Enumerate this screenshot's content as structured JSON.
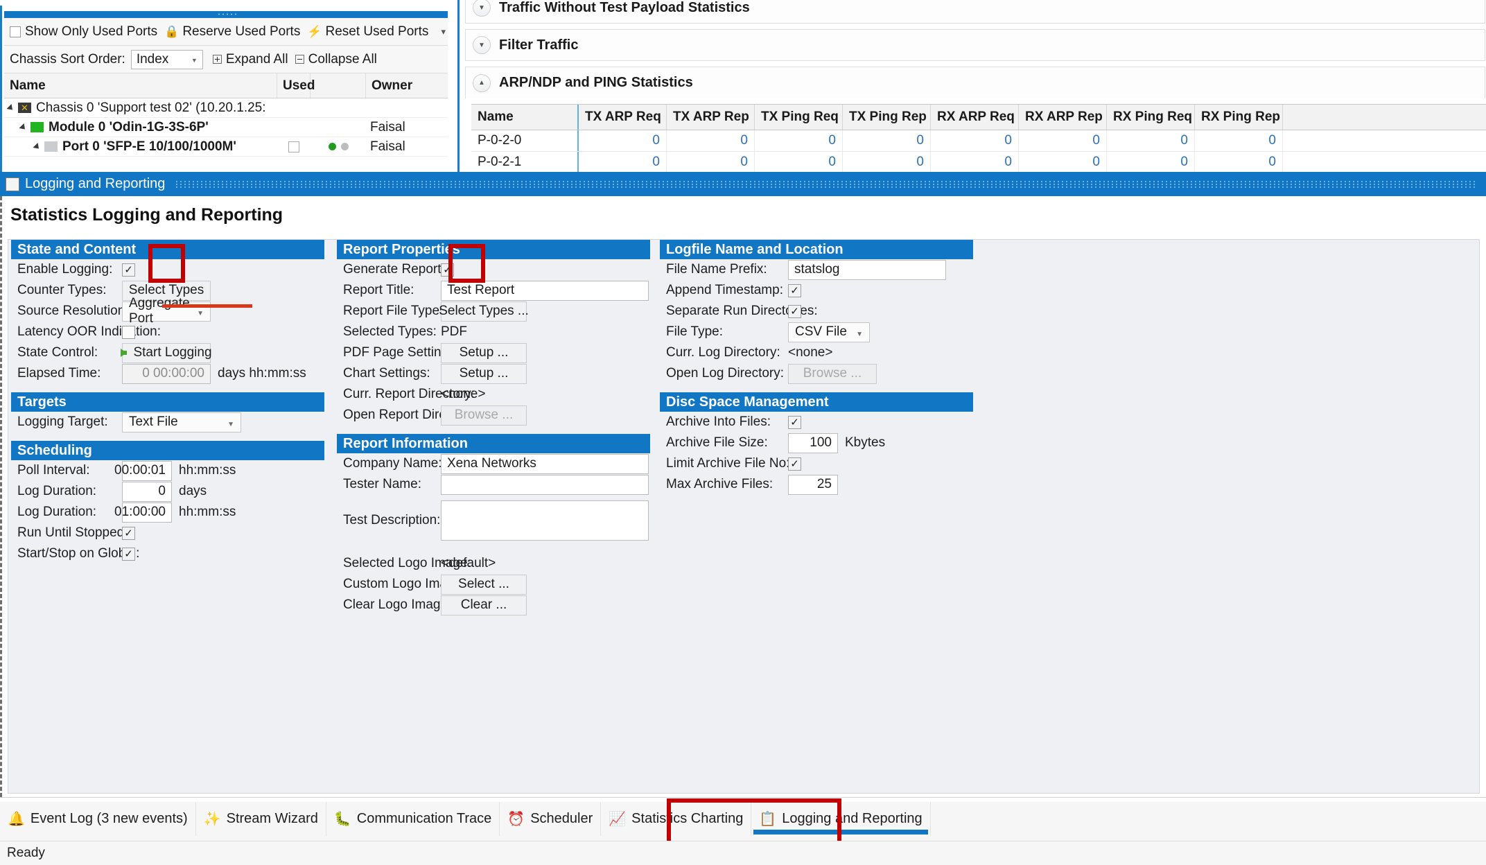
{
  "port_panel": {
    "toolbar": {
      "show_only_used_ports": "Show Only Used Ports",
      "reserve_used_ports": "Reserve Used Ports",
      "reset_used_ports": "Reset Used Ports",
      "chassis_sort_order_label": "Chassis Sort Order:",
      "chassis_sort_order_value": "Index",
      "expand_all": "Expand All",
      "collapse_all": "Collapse All"
    },
    "columns": [
      "Name",
      "Used",
      "",
      "Owner"
    ],
    "rows": [
      {
        "name": "Chassis 0 'Support test 02' (10.20.1.25:",
        "used": "",
        "owner": ""
      },
      {
        "name": "Module 0 'Odin-1G-3S-6P'",
        "used": "",
        "owner": "Faisal"
      },
      {
        "name": "Port 0 'SFP-E 10/100/1000M'",
        "used": "",
        "owner": "Faisal"
      }
    ]
  },
  "stats_panel": {
    "sections": [
      {
        "label": "Traffic Without Test Payload Statistics",
        "expanded": false
      },
      {
        "label": "Filter Traffic",
        "expanded": false
      },
      {
        "label": "ARP/NDP and PING Statistics",
        "expanded": true
      }
    ],
    "table": {
      "columns": [
        "Name",
        "TX ARP Req",
        "TX ARP Rep",
        "TX Ping Req",
        "TX Ping Rep",
        "RX ARP Req",
        "RX ARP Rep",
        "RX Ping Req",
        "RX Ping Rep",
        ""
      ],
      "rows": [
        [
          "P-0-2-0",
          "0",
          "0",
          "0",
          "0",
          "0",
          "0",
          "0",
          "0",
          ""
        ],
        [
          "P-0-2-1",
          "0",
          "0",
          "0",
          "0",
          "0",
          "0",
          "0",
          "0",
          ""
        ]
      ]
    }
  },
  "panel": {
    "titlebar": "Logging and Reporting",
    "page_title": "Statistics Logging and Reporting"
  },
  "state_and_content": {
    "header": "State and Content",
    "enable_logging_label": "Enable Logging:",
    "enable_logging_checked": "✓",
    "counter_types_label": "Counter Types:",
    "counter_types_button": "Select Types",
    "source_resolution_label": "Source Resolution:",
    "source_resolution_value": "Aggregate Port",
    "latency_oor_label": "Latency OOR Indication:",
    "latency_oor_checked": "",
    "state_control_label": "State Control:",
    "state_control_button": "Start Logging",
    "elapsed_time_label": "Elapsed Time:",
    "elapsed_time_value": "0 00:00:00",
    "elapsed_time_unit": "days hh:mm:ss"
  },
  "targets": {
    "header": "Targets",
    "logging_target_label": "Logging Target:",
    "logging_target_value": "Text File"
  },
  "scheduling": {
    "header": "Scheduling",
    "poll_interval_label": "Poll Interval:",
    "poll_interval_value": "00:00:01",
    "poll_interval_unit": "hh:mm:ss",
    "log_duration_days_label": "Log Duration:",
    "log_duration_days_value": "0",
    "log_duration_days_unit": "days",
    "log_duration_time_label": "Log Duration:",
    "log_duration_time_value": "01:00:00",
    "log_duration_time_unit": "hh:mm:ss",
    "run_until_stopped_label": "Run Until Stopped:",
    "run_until_stopped_checked": "✓",
    "start_stop_global_label": "Start/Stop on Global:",
    "start_stop_global_checked": "✓"
  },
  "report_properties": {
    "header": "Report Properties",
    "generate_report_label": "Generate Report:",
    "generate_report_checked": "✓",
    "report_title_label": "Report Title:",
    "report_title_value": "Test Report",
    "report_file_types_label": "Report File Types:",
    "report_file_types_button": "Select Types ...",
    "selected_types_label": "Selected Types:",
    "selected_types_value": "PDF",
    "pdf_page_settings_label": "PDF Page Settings:",
    "pdf_page_settings_button": "Setup ...",
    "chart_settings_label": "Chart Settings:",
    "chart_settings_button": "Setup ...",
    "curr_report_directory_label": "Curr. Report Directory:",
    "curr_report_directory_value": "<none>",
    "open_report_directory_label": "Open Report Directory:",
    "open_report_directory_button": "Browse ..."
  },
  "report_information": {
    "header": "Report Information",
    "company_name_label": "Company Name:",
    "company_name_value": "Xena Networks",
    "tester_name_label": "Tester Name:",
    "tester_name_value": "",
    "test_description_label": "Test Description:",
    "test_description_value": "",
    "selected_logo_image_label": "Selected Logo Image:",
    "selected_logo_image_value": "<default>",
    "custom_logo_image_label": "Custom Logo Image:",
    "custom_logo_image_button": "Select ...",
    "clear_logo_image_label": "Clear Logo Image:",
    "clear_logo_image_button": "Clear ..."
  },
  "logfile_name_location": {
    "header": "Logfile Name and Location",
    "file_name_prefix_label": "File Name Prefix:",
    "file_name_prefix_value": "statslog",
    "append_timestamp_label": "Append Timestamp:",
    "append_timestamp_checked": "✓",
    "separate_run_directories_label": "Separate Run Directories:",
    "separate_run_directories_checked": "✓",
    "file_type_label": "File Type:",
    "file_type_value": "CSV File",
    "curr_log_directory_label": "Curr. Log Directory:",
    "curr_log_directory_value": "<none>",
    "open_log_directory_label": "Open Log Directory:",
    "open_log_directory_button": "Browse ..."
  },
  "disc_space_management": {
    "header": "Disc Space Management",
    "archive_into_files_label": "Archive Into Files:",
    "archive_into_files_checked": "✓",
    "archive_file_size_label": "Archive File Size:",
    "archive_file_size_value": "100",
    "archive_file_size_unit": "Kbytes",
    "limit_archive_file_no_label": "Limit Archive File No:",
    "limit_archive_file_no_checked": "✓",
    "max_archive_files_label": "Max Archive Files:",
    "max_archive_files_value": "25"
  },
  "taskbar": {
    "items": [
      {
        "label": "Event Log (3 new events)",
        "icon": "bell-icon",
        "glyph": "🔔",
        "active": false
      },
      {
        "label": "Stream Wizard",
        "icon": "wand-icon",
        "glyph": "🪄",
        "active": false
      },
      {
        "label": "Communication Trace",
        "icon": "bug-icon",
        "glyph": "🐛",
        "active": false
      },
      {
        "label": "Scheduler",
        "icon": "clock-icon",
        "glyph": "⏰",
        "active": false
      },
      {
        "label": "Statistics Charting",
        "icon": "chart-icon",
        "glyph": "📈",
        "active": false
      },
      {
        "label": "Logging and Reporting",
        "icon": "report-icon",
        "glyph": "📑",
        "active": true
      }
    ]
  },
  "statusbar": {
    "text": "Ready"
  },
  "colors": {
    "header_blue": "#1177c4",
    "panel_bg": "#eef0f4",
    "annotation_red": "#c00000",
    "underline_red": "#d8391b",
    "led_on": "#1f9c1f",
    "led_off": "#bdbdbd"
  }
}
